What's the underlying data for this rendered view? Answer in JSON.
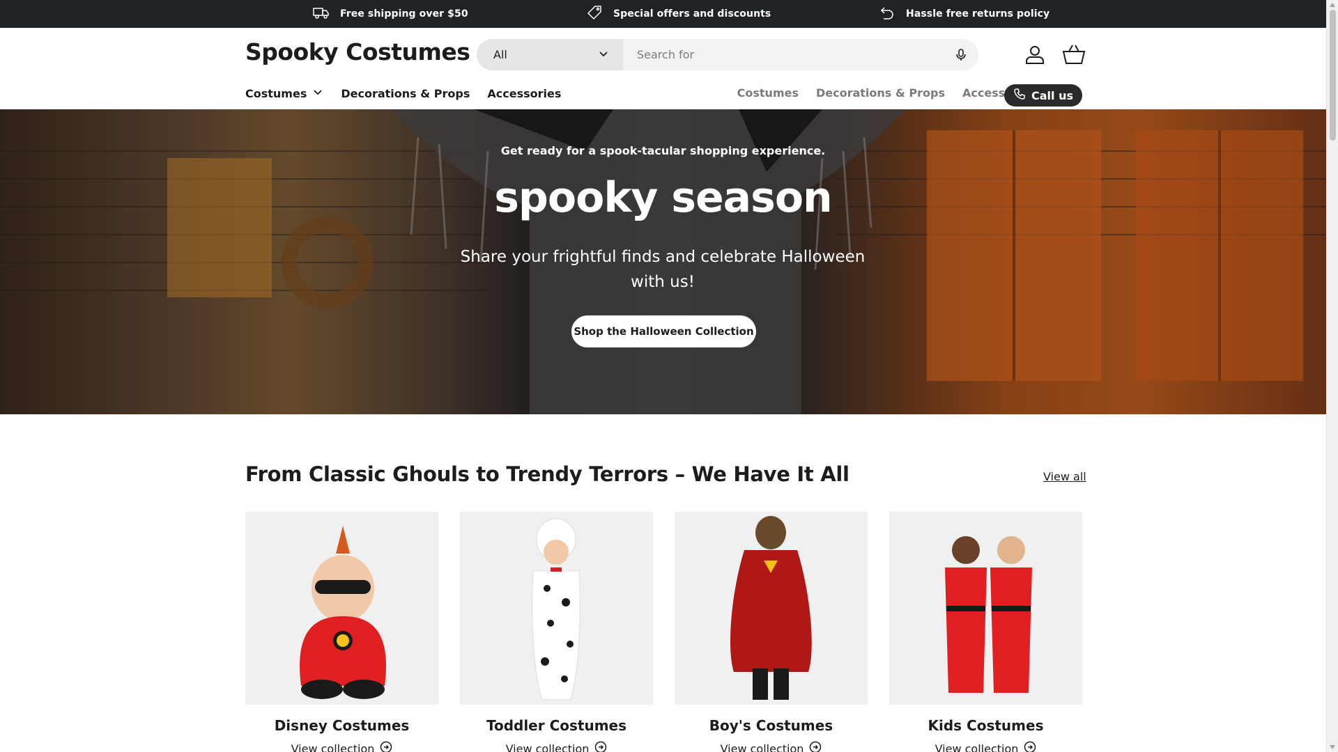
{
  "announcement": {
    "items": [
      {
        "icon": "truck-icon",
        "text": "Free shipping over $50"
      },
      {
        "icon": "tag-icon",
        "text": "Special offers and discounts"
      },
      {
        "icon": "return-arrow-icon",
        "text": "Hassle free returns policy"
      }
    ]
  },
  "header": {
    "logo": "Spooky Costumes",
    "search": {
      "category": "All",
      "placeholder": "Search for"
    }
  },
  "nav": {
    "primary": [
      "Costumes",
      "Decorations & Props",
      "Accessories"
    ],
    "secondary": [
      "Costumes",
      "Decorations & Props",
      "Accessories"
    ],
    "call_label": "Call us"
  },
  "hero": {
    "eyebrow": "Get ready for a spook-tacular shopping experience.",
    "title": "spooky season",
    "subtitle": "Share your frightful finds and celebrate Halloween with us!",
    "cta": "Shop the Halloween Collection"
  },
  "collections": {
    "title": "From Classic Ghouls to Trendy Terrors – We Have It All",
    "view_all": "View all",
    "link_label": "View collection",
    "cards": [
      {
        "title": "Disney Costumes"
      },
      {
        "title": "Toddler Costumes"
      },
      {
        "title": "Boy's Costumes"
      },
      {
        "title": "Kids Costumes"
      }
    ]
  },
  "colors": {
    "announcement_bg": "#1f2327",
    "call_button_bg": "#2a2a2a",
    "muted_nav": "#7b7b7b"
  }
}
